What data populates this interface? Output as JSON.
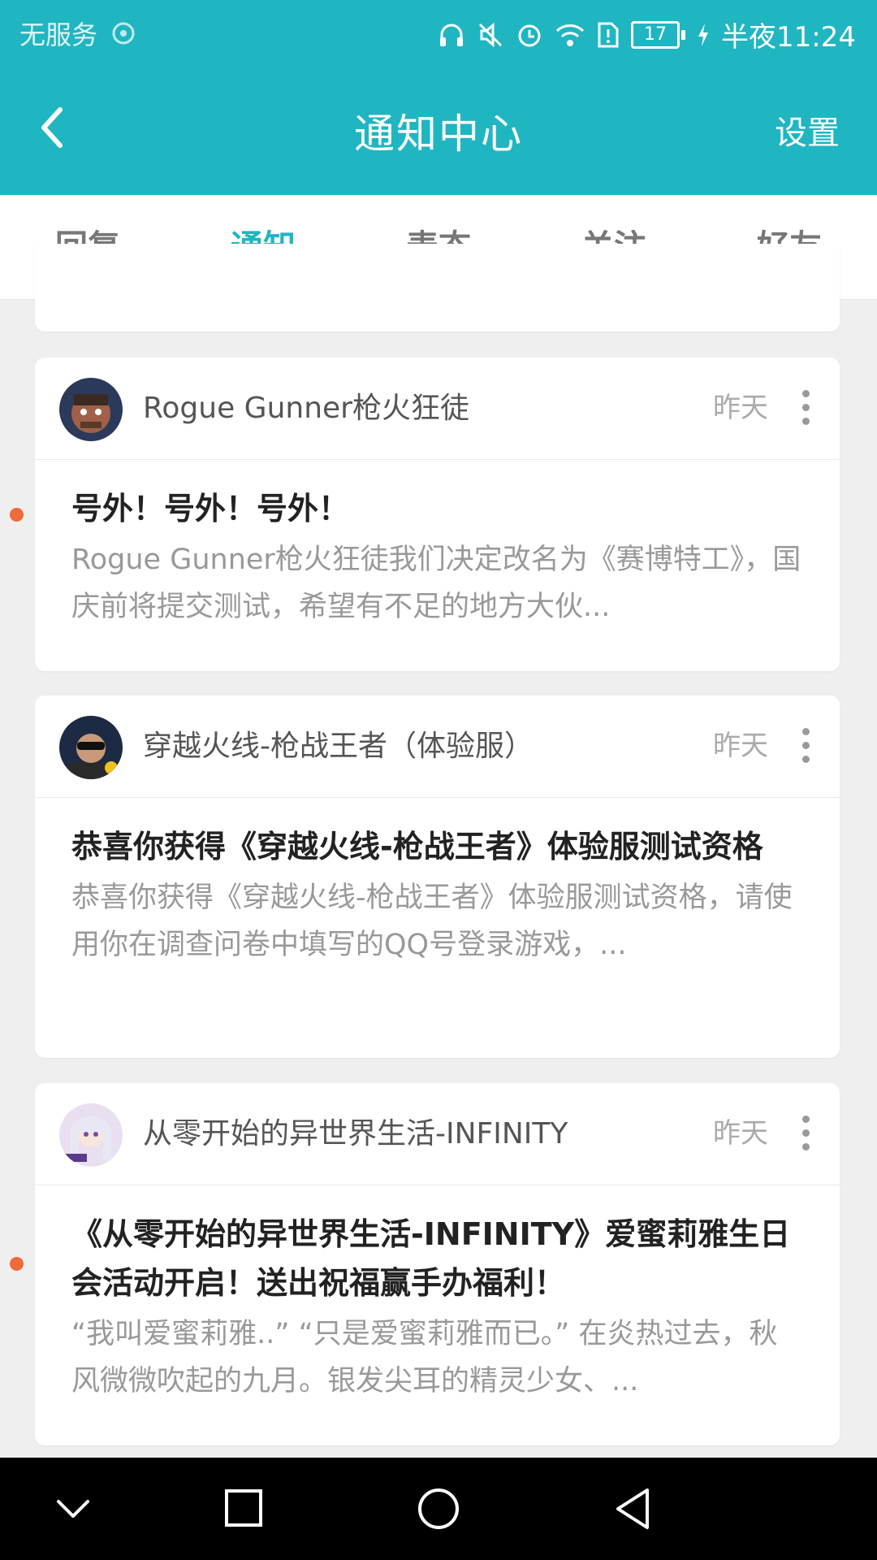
{
  "status_bar": {
    "carrier": "无服务",
    "battery": "17",
    "time": "半夜11:24"
  },
  "header": {
    "title": "通知中心",
    "settings_label": "设置"
  },
  "tabs": [
    {
      "label": "回复",
      "active": false
    },
    {
      "label": "通知",
      "active": true
    },
    {
      "label": "表态",
      "active": false
    },
    {
      "label": "关注",
      "active": false
    },
    {
      "label": "好友",
      "active": false
    }
  ],
  "notifications": [
    {
      "source": "Rogue Gunner枪火狂徒",
      "time": "昨天",
      "unread": true,
      "headline": "号外！号外！号外！",
      "summary": "Rogue Gunner枪火狂徒我们决定改名为《赛博特工》，国庆前将提交测试，希望有不足的地方大伙..."
    },
    {
      "source": "穿越火线-枪战王者（体验服）",
      "time": "昨天",
      "unread": false,
      "headline": "恭喜你获得《穿越火线-枪战王者》体验服测试资格",
      "summary": "恭喜你获得《穿越火线-枪战王者》体验服测试资格，请使用你在调查问卷中填写的QQ号登录游戏，..."
    },
    {
      "source": "从零开始的异世界生活-INFINITY",
      "time": "昨天",
      "unread": true,
      "headline": "《从零开始的异世界生活-INFINITY》爱蜜莉雅生日会活动开启！送出祝福赢手办福利！",
      "summary": "“我叫爱蜜莉雅..” “只是爱蜜莉雅而已。” 在炎热过去，秋风微微吹起的九月。银发尖耳的精灵少女、..."
    }
  ],
  "colors": {
    "accent": "#1fb6c2",
    "unread_dot": "#f06a3b"
  }
}
